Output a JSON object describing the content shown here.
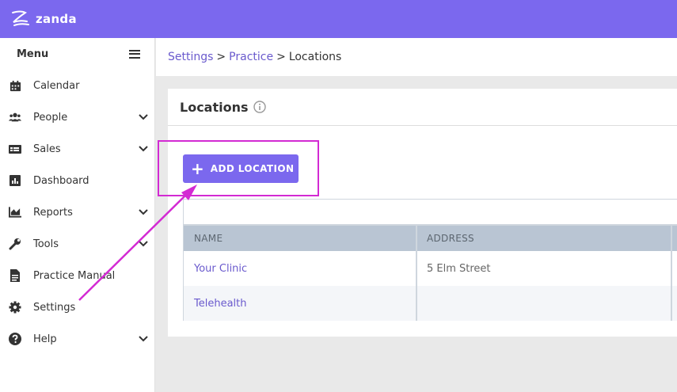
{
  "app": {
    "brand": "zanda"
  },
  "sidebar": {
    "title": "Menu",
    "items": [
      {
        "label": "Calendar",
        "icon": "calendar-icon",
        "expandable": false
      },
      {
        "label": "People",
        "icon": "people-icon",
        "expandable": true
      },
      {
        "label": "Sales",
        "icon": "sales-icon",
        "expandable": true
      },
      {
        "label": "Dashboard",
        "icon": "dashboard-icon",
        "expandable": false
      },
      {
        "label": "Reports",
        "icon": "reports-icon",
        "expandable": true
      },
      {
        "label": "Tools",
        "icon": "wrench-icon",
        "expandable": true
      },
      {
        "label": "Practice Manual",
        "icon": "document-icon",
        "expandable": false
      },
      {
        "label": "Settings",
        "icon": "gear-icon",
        "expandable": false
      },
      {
        "label": "Help",
        "icon": "help-icon",
        "expandable": true
      }
    ]
  },
  "breadcrumb": {
    "items": [
      "Settings",
      "Practice",
      "Locations"
    ],
    "separator": ">"
  },
  "page": {
    "title": "Locations",
    "add_button": "ADD LOCATION"
  },
  "table": {
    "columns": [
      "NAME",
      "ADDRESS"
    ],
    "rows": [
      {
        "name": "Your Clinic",
        "address": "5 Elm Street"
      },
      {
        "name": "Telehealth",
        "address": ""
      }
    ]
  },
  "colors": {
    "brand": "#7b68ee",
    "link": "#6a5acd",
    "annotation": "#d32ad3",
    "table_header": "#b9c5d3"
  }
}
